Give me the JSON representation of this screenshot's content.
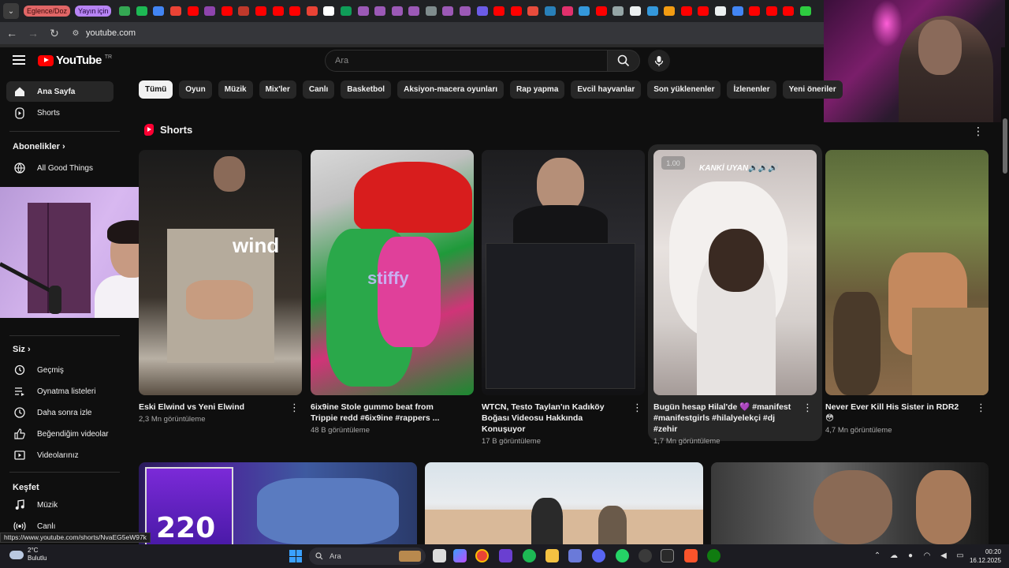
{
  "browser": {
    "tab_groups": [
      "Eglence/Doz",
      "Yayın için"
    ],
    "url": "youtube.com"
  },
  "youtube": {
    "logo_text": "YouTube",
    "logo_region": "TR",
    "search_placeholder": "Ara",
    "chips": [
      "Tümü",
      "Oyun",
      "Müzik",
      "Mix'ler",
      "Canlı",
      "Basketbol",
      "Aksiyon-macera oyunları",
      "Rap yapma",
      "Evcil hayvanlar",
      "Son yüklenenler",
      "İzlenenler",
      "Yeni öneriler"
    ],
    "sidebar": {
      "main": [
        {
          "label": "Ana Sayfa",
          "icon": "home-icon"
        },
        {
          "label": "Shorts",
          "icon": "shorts-icon"
        }
      ],
      "subscriptions_head": "Abonelikler",
      "subscriptions": [
        {
          "label": "All Good Things",
          "icon": "channel-avatar-icon"
        }
      ],
      "you_head": "Siz",
      "you": [
        {
          "label": "Geçmiş",
          "icon": "history-icon"
        },
        {
          "label": "Oynatma listeleri",
          "icon": "playlist-icon"
        },
        {
          "label": "Daha sonra izle",
          "icon": "watch-later-icon"
        },
        {
          "label": "Beğendiğim videolar",
          "icon": "thumbs-up-icon"
        },
        {
          "label": "Videolarınız",
          "icon": "your-videos-icon"
        }
      ],
      "explore_head": "Keşfet",
      "explore": [
        {
          "label": "Müzik",
          "icon": "music-icon"
        },
        {
          "label": "Canlı",
          "icon": "live-icon"
        }
      ]
    },
    "shorts_title": "Shorts",
    "shorts": [
      {
        "title": "Eski Elwind vs Yeni Elwind",
        "views": "2,3 Mn görüntüleme",
        "overlay": "wind"
      },
      {
        "title": "6ix9ine Stole gummo beat from Trippie redd #6ix9ine #rappers ...",
        "views": "48 B görüntüleme",
        "overlay": "stiffy"
      },
      {
        "title": "WTCN, Testo Taylan'ın Kadıköy Boğası Videosu Hakkında Konuşuyor",
        "views": "17 B görüntüleme",
        "overlay": ""
      },
      {
        "title": "Bugün hesap Hilal'de 💜 #manifest #manifestgirls #hilalyelekçi #dj #zehir",
        "views": "1,7 Mn görüntüleme",
        "overlay": "KANKİ UYAN🔊🔊🔊",
        "badge": "1.00"
      },
      {
        "title": "Never Ever Kill His Sister in RDR2 😳",
        "views": "4,7 Mn görüntüleme",
        "overlay": ""
      }
    ],
    "video_row": [
      {
        "overlay": "220"
      },
      {
        "overlay": ""
      },
      {
        "overlay": ""
      }
    ]
  },
  "status_url": "https://www.youtube.com/shorts/NvaEG5eW97k",
  "taskbar": {
    "weather_temp": "2°C",
    "weather_desc": "Bulutlu",
    "search_label": "Ara",
    "time": "00:20",
    "date": "16.12.2025"
  },
  "colors": {
    "bg": "#0f0f0f",
    "chip": "#272727",
    "accent_red": "#ff0000"
  }
}
